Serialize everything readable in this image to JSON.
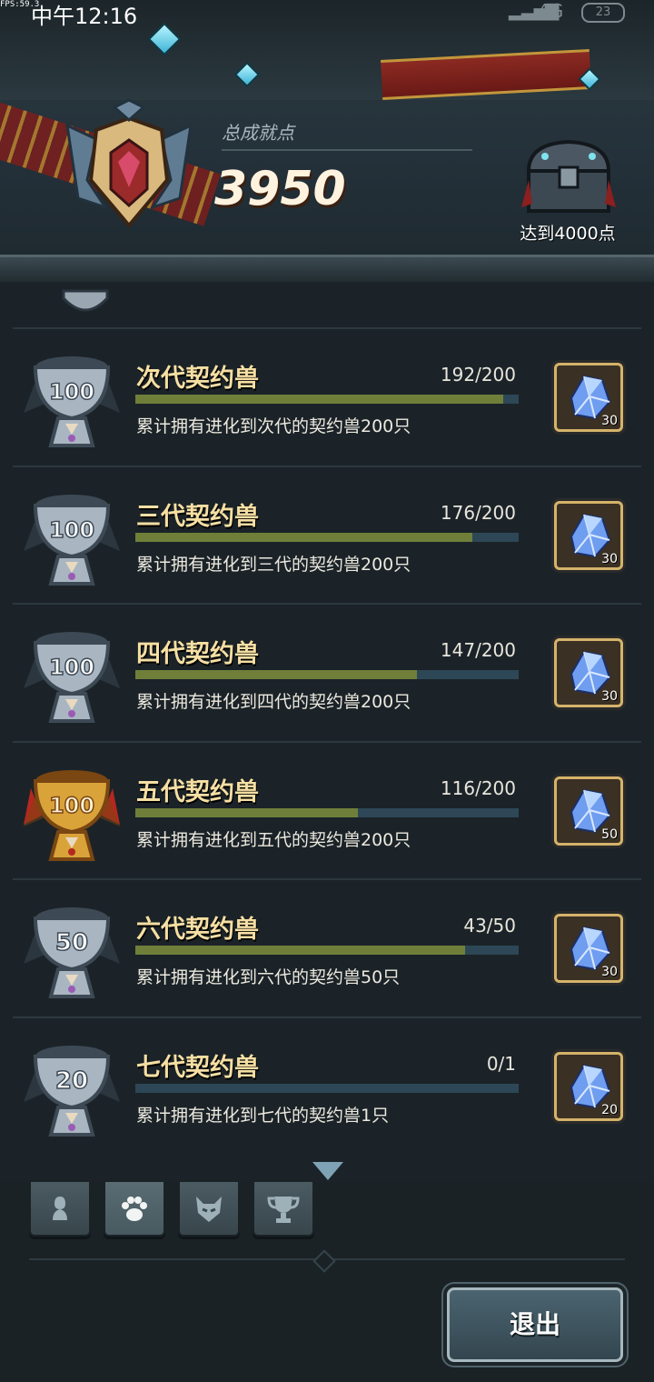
{
  "status_bar": {
    "fps": "FPS:59.3",
    "time": "中午12:16",
    "network": "4G",
    "battery": "23"
  },
  "header": {
    "total_label": "总成就点",
    "total_value": "3950",
    "chest_label": "达到4000点"
  },
  "achievements": [
    {
      "title": "次代契约兽",
      "progress": "192/200",
      "current": 192,
      "target": 200,
      "desc": "累计拥有进化到次代的契约兽200只",
      "trophy_points": "100",
      "trophy_tier": "silver",
      "reward_qty": "30"
    },
    {
      "title": "三代契约兽",
      "progress": "176/200",
      "current": 176,
      "target": 200,
      "desc": "累计拥有进化到三代的契约兽200只",
      "trophy_points": "100",
      "trophy_tier": "silver",
      "reward_qty": "30"
    },
    {
      "title": "四代契约兽",
      "progress": "147/200",
      "current": 147,
      "target": 200,
      "desc": "累计拥有进化到四代的契约兽200只",
      "trophy_points": "100",
      "trophy_tier": "silver",
      "reward_qty": "30"
    },
    {
      "title": "五代契约兽",
      "progress": "116/200",
      "current": 116,
      "target": 200,
      "desc": "累计拥有进化到五代的契约兽200只",
      "trophy_points": "100",
      "trophy_tier": "gold",
      "reward_qty": "50"
    },
    {
      "title": "六代契约兽",
      "progress": "43/50",
      "current": 43,
      "target": 50,
      "desc": "累计拥有进化到六代的契约兽50只",
      "trophy_points": "50",
      "trophy_tier": "silver",
      "reward_qty": "30"
    },
    {
      "title": "七代契约兽",
      "progress": "0/1",
      "current": 0,
      "target": 1,
      "desc": "累计拥有进化到七代的契约兽1只",
      "trophy_points": "20",
      "trophy_tier": "silver",
      "reward_qty": "20"
    }
  ],
  "tabs": [
    {
      "icon": "character-icon",
      "active": false
    },
    {
      "icon": "paw-icon",
      "active": true
    },
    {
      "icon": "demon-mask-icon",
      "active": false
    },
    {
      "icon": "trophy-icon",
      "active": false
    }
  ],
  "footer": {
    "exit_label": "退出"
  },
  "colors": {
    "progress_fill": "#6f7f3a",
    "progress_track": "#2d4756",
    "title_gold": "#f6dfa3",
    "reward_border": "#d4b36a"
  }
}
